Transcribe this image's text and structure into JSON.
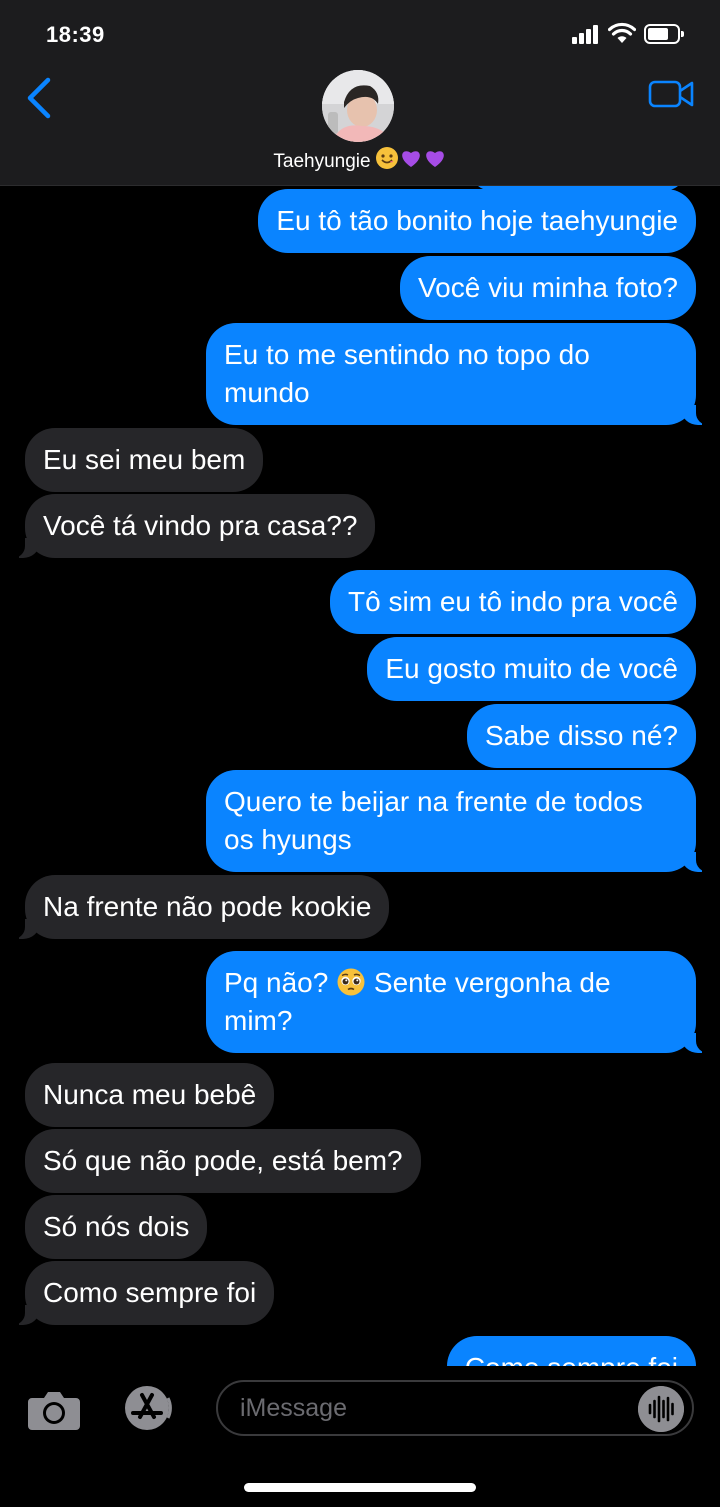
{
  "status_bar": {
    "time": "18:39"
  },
  "contact": {
    "name": "Taehyungie",
    "name_emojis": [
      "smiling-face-emoji",
      "purple-heart-emoji",
      "purple-heart-emoji"
    ]
  },
  "messages": [
    {
      "from": "me",
      "text": "Eu tô tão bonito hoje taehyungie"
    },
    {
      "from": "me",
      "text": "Você viu minha foto?"
    },
    {
      "from": "me",
      "text": "Eu to me sentindo no topo do mundo"
    },
    {
      "from": "them",
      "text": "Eu sei meu bem"
    },
    {
      "from": "them",
      "text": "Você tá vindo pra casa??"
    },
    {
      "from": "me",
      "text": "Tô sim eu tô indo pra você"
    },
    {
      "from": "me",
      "text": "Eu gosto muito de você"
    },
    {
      "from": "me",
      "text": "Sabe disso né?"
    },
    {
      "from": "me",
      "text": "Quero te beijar na frente de todos os hyungs"
    },
    {
      "from": "them",
      "text": "Na frente não pode kookie"
    },
    {
      "from": "me",
      "text_before": "Pq não?",
      "emoji": "pleading-face-emoji",
      "text_after": "Sente vergonha de mim?"
    },
    {
      "from": "them",
      "text": "Nunca meu bebê"
    },
    {
      "from": "them",
      "text": "Só que não pode, está bem?"
    },
    {
      "from": "them",
      "text": "Só nós dois"
    },
    {
      "from": "them",
      "text": "Como sempre foi"
    },
    {
      "from": "me",
      "text": "Como sempre foi"
    }
  ],
  "input": {
    "placeholder": "iMessage"
  },
  "colors": {
    "sent_bubble": "#0a84ff",
    "received_bubble": "#262629",
    "header_bg": "#1c1c1e",
    "accent": "#0a84ff"
  }
}
